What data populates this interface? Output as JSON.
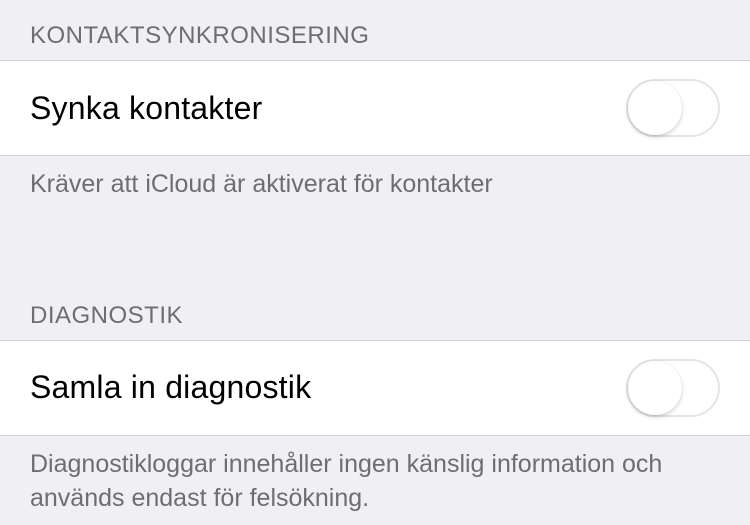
{
  "sections": [
    {
      "header": "KONTAKTSYNKRONISERING",
      "cell": {
        "label": "Synka kontakter",
        "toggle": false
      },
      "footer": "Kräver att iCloud är aktiverat för kontakter"
    },
    {
      "header": "DIAGNOSTIK",
      "cell": {
        "label": "Samla in diagnostik",
        "toggle": false
      },
      "footer": "Diagnostikloggar innehåller ingen känslig information och används endast för felsökning."
    }
  ]
}
